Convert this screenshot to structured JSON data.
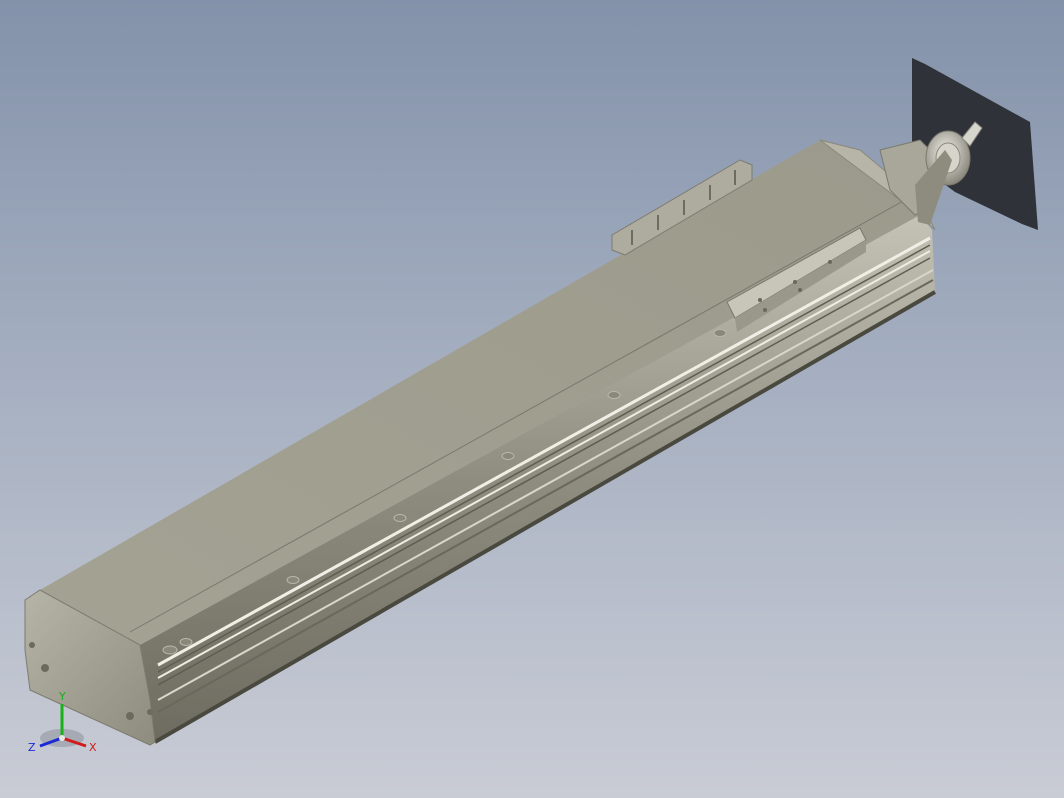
{
  "viewport": {
    "background_top": "#8392aa",
    "background_bottom": "#c9ccd5"
  },
  "model": {
    "body_color": "#a19f90",
    "shadow_color": "#2a2c33"
  },
  "triad": {
    "x_label": "X",
    "y_label": "Y",
    "z_label": "Z",
    "x_color": "#d11a1a",
    "y_color": "#19b019",
    "z_color": "#1a2ad6"
  }
}
